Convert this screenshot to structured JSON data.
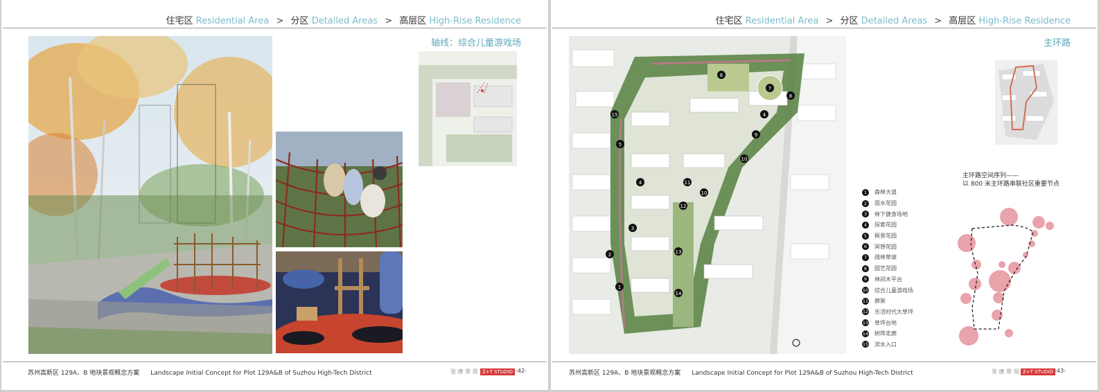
{
  "breadcrumb": {
    "area_zh": "住宅区",
    "area_en": "Residential Area",
    "sub_zh": "分区",
    "sub_en": "Detailed Areas",
    "zone_zh": "高层区",
    "zone_en": "High-Rise Residence",
    "separator": ">"
  },
  "left_page": {
    "section_title": "轴线：综合儿童游戏场",
    "page_number": "-42-"
  },
  "right_page": {
    "section_title": "主环路",
    "note_line1": "主环路空间序列——",
    "note_line2": "以 800 米主环路串联社区重要节点",
    "page_number": "-43-",
    "legend": [
      {
        "num": "1",
        "label": "森林大道"
      },
      {
        "num": "2",
        "label": "雨水花园"
      },
      {
        "num": "3",
        "label": "林下健身场地"
      },
      {
        "num": "4",
        "label": "探索花园"
      },
      {
        "num": "5",
        "label": "枫景花园"
      },
      {
        "num": "6",
        "label": "冥想花园"
      },
      {
        "num": "7",
        "label": "疏林草坡"
      },
      {
        "num": "8",
        "label": "园艺花园"
      },
      {
        "num": "9",
        "label": "林间木平台"
      },
      {
        "num": "10",
        "label": "综合儿童游戏场"
      },
      {
        "num": "11",
        "label": "廊架"
      },
      {
        "num": "12",
        "label": "乐活时代大草坪"
      },
      {
        "num": "13",
        "label": "草坪台地"
      },
      {
        "num": "14",
        "label": "树阵走廊"
      },
      {
        "num": "15",
        "label": "滨水入口"
      }
    ]
  },
  "footer": {
    "project_zh": "苏州高新区 129A、B 地块景观概念方案",
    "project_en": "Landscape Initial Concept for Plot 129A&B of Suzhou High-Tech District",
    "brand": "张 唐 景 观",
    "studio": "Z+T STUDIO"
  },
  "colors": {
    "accent": "#7bbccb",
    "node_pink": "#e9a3aa",
    "studio_red": "#d63a3a",
    "plan_green": "#55803e"
  }
}
